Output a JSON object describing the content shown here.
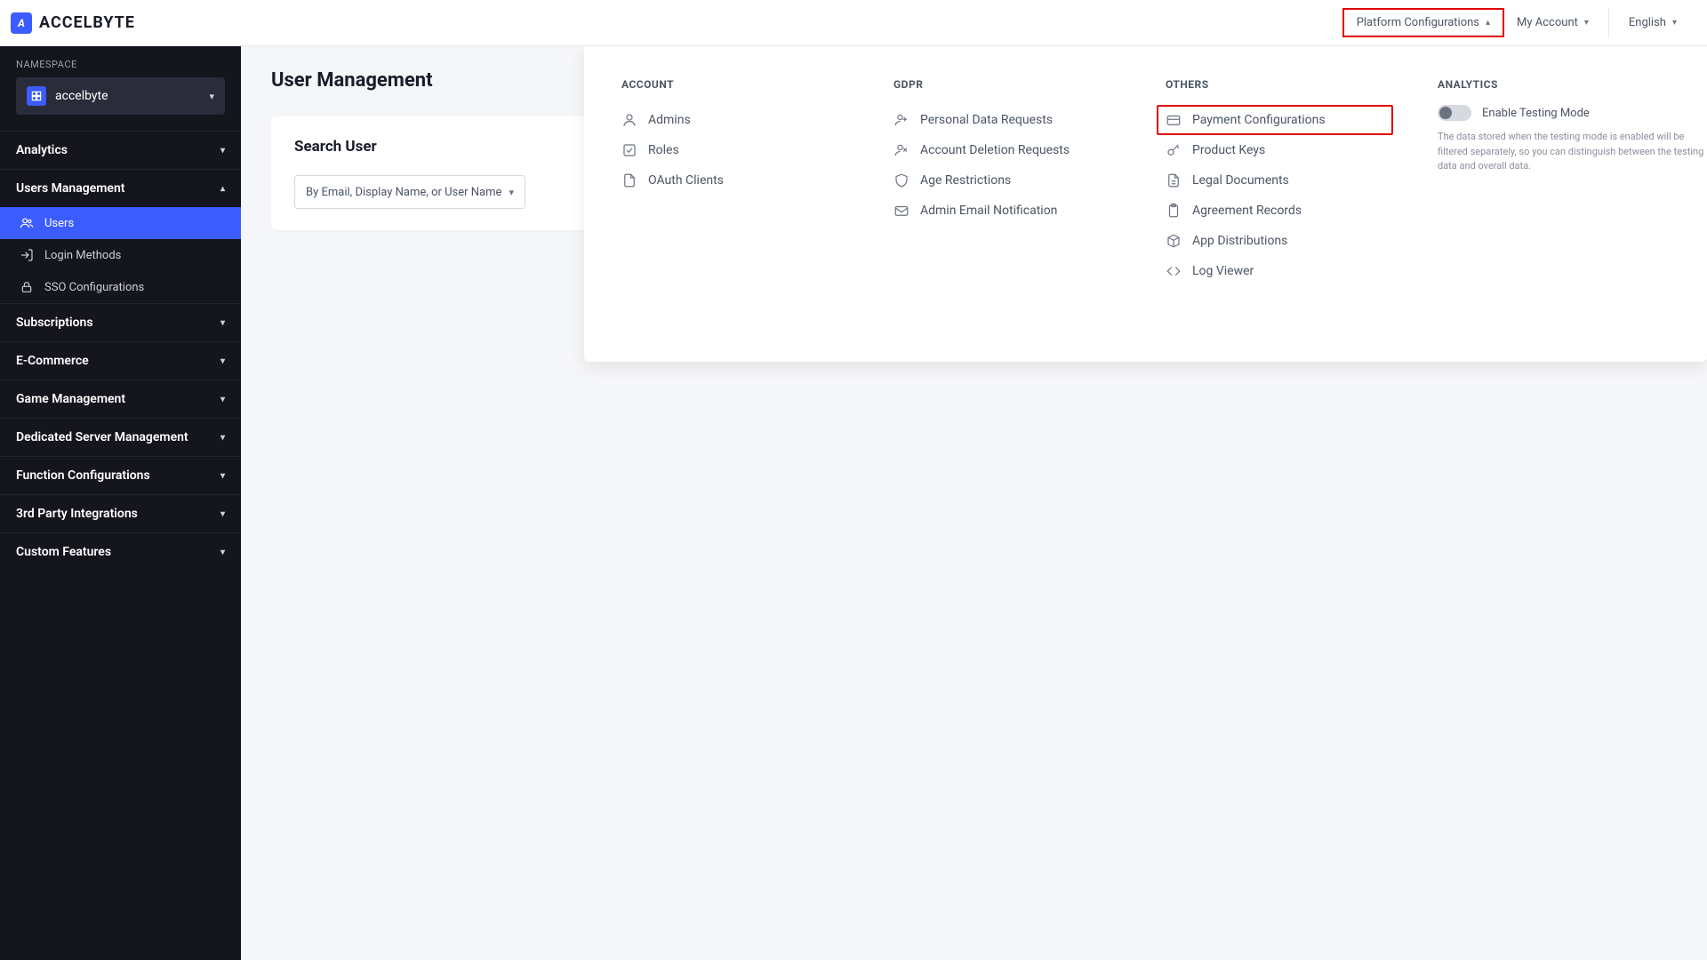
{
  "brand": {
    "logo_letter": "A",
    "name": "ACCELBYTE"
  },
  "header": {
    "platform_config": "Platform Configurations",
    "my_account": "My Account",
    "language": "English"
  },
  "sidebar": {
    "namespace_label": "NAMESPACE",
    "namespace_value": "accelbyte",
    "groups": {
      "analytics": "Analytics",
      "users_mgmt": "Users Management",
      "subscriptions": "Subscriptions",
      "ecommerce": "E-Commerce",
      "game_mgmt": "Game Management",
      "dedicated_server": "Dedicated Server Management",
      "function_config": "Function Configurations",
      "third_party": "3rd Party Integrations",
      "custom_features": "Custom Features"
    },
    "users_sub": {
      "users": "Users",
      "login_methods": "Login Methods",
      "sso": "SSO Configurations"
    }
  },
  "main": {
    "page_title": "User Management",
    "search_card_title": "Search User",
    "search_select": "By Email, Display Name, or User Name"
  },
  "panel": {
    "account": {
      "title": "ACCOUNT",
      "admins": "Admins",
      "roles": "Roles",
      "oauth": "OAuth Clients"
    },
    "gdpr": {
      "title": "GDPR",
      "personal_data": "Personal Data Requests",
      "account_deletion": "Account Deletion Requests",
      "age_restrictions": "Age Restrictions",
      "admin_email": "Admin Email Notification"
    },
    "others": {
      "title": "OTHERS",
      "payment_config": "Payment Configurations",
      "product_keys": "Product Keys",
      "legal_docs": "Legal Documents",
      "agreement_records": "Agreement Records",
      "app_dist": "App Distributions",
      "log_viewer": "Log Viewer"
    },
    "analytics": {
      "title": "ANALYTICS",
      "toggle_label": "Enable Testing Mode",
      "description": "The data stored when the testing mode is enabled will be filtered separately, so you can distinguish between the testing data and overall data."
    }
  }
}
